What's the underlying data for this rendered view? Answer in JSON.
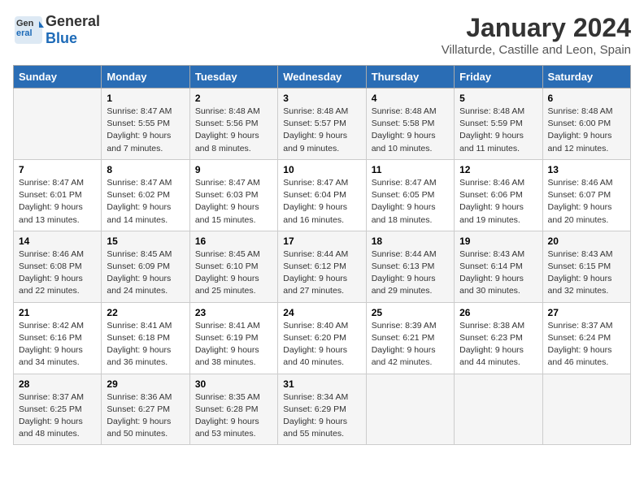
{
  "logo": {
    "general": "General",
    "blue": "Blue"
  },
  "title": "January 2024",
  "subtitle": "Villaturde, Castille and Leon, Spain",
  "days_header": [
    "Sunday",
    "Monday",
    "Tuesday",
    "Wednesday",
    "Thursday",
    "Friday",
    "Saturday"
  ],
  "weeks": [
    [
      {
        "num": "",
        "lines": []
      },
      {
        "num": "1",
        "lines": [
          "Sunrise: 8:47 AM",
          "Sunset: 5:55 PM",
          "Daylight: 9 hours",
          "and 7 minutes."
        ]
      },
      {
        "num": "2",
        "lines": [
          "Sunrise: 8:48 AM",
          "Sunset: 5:56 PM",
          "Daylight: 9 hours",
          "and 8 minutes."
        ]
      },
      {
        "num": "3",
        "lines": [
          "Sunrise: 8:48 AM",
          "Sunset: 5:57 PM",
          "Daylight: 9 hours",
          "and 9 minutes."
        ]
      },
      {
        "num": "4",
        "lines": [
          "Sunrise: 8:48 AM",
          "Sunset: 5:58 PM",
          "Daylight: 9 hours",
          "and 10 minutes."
        ]
      },
      {
        "num": "5",
        "lines": [
          "Sunrise: 8:48 AM",
          "Sunset: 5:59 PM",
          "Daylight: 9 hours",
          "and 11 minutes."
        ]
      },
      {
        "num": "6",
        "lines": [
          "Sunrise: 8:48 AM",
          "Sunset: 6:00 PM",
          "Daylight: 9 hours",
          "and 12 minutes."
        ]
      }
    ],
    [
      {
        "num": "7",
        "lines": [
          "Sunrise: 8:47 AM",
          "Sunset: 6:01 PM",
          "Daylight: 9 hours",
          "and 13 minutes."
        ]
      },
      {
        "num": "8",
        "lines": [
          "Sunrise: 8:47 AM",
          "Sunset: 6:02 PM",
          "Daylight: 9 hours",
          "and 14 minutes."
        ]
      },
      {
        "num": "9",
        "lines": [
          "Sunrise: 8:47 AM",
          "Sunset: 6:03 PM",
          "Daylight: 9 hours",
          "and 15 minutes."
        ]
      },
      {
        "num": "10",
        "lines": [
          "Sunrise: 8:47 AM",
          "Sunset: 6:04 PM",
          "Daylight: 9 hours",
          "and 16 minutes."
        ]
      },
      {
        "num": "11",
        "lines": [
          "Sunrise: 8:47 AM",
          "Sunset: 6:05 PM",
          "Daylight: 9 hours",
          "and 18 minutes."
        ]
      },
      {
        "num": "12",
        "lines": [
          "Sunrise: 8:46 AM",
          "Sunset: 6:06 PM",
          "Daylight: 9 hours",
          "and 19 minutes."
        ]
      },
      {
        "num": "13",
        "lines": [
          "Sunrise: 8:46 AM",
          "Sunset: 6:07 PM",
          "Daylight: 9 hours",
          "and 20 minutes."
        ]
      }
    ],
    [
      {
        "num": "14",
        "lines": [
          "Sunrise: 8:46 AM",
          "Sunset: 6:08 PM",
          "Daylight: 9 hours",
          "and 22 minutes."
        ]
      },
      {
        "num": "15",
        "lines": [
          "Sunrise: 8:45 AM",
          "Sunset: 6:09 PM",
          "Daylight: 9 hours",
          "and 24 minutes."
        ]
      },
      {
        "num": "16",
        "lines": [
          "Sunrise: 8:45 AM",
          "Sunset: 6:10 PM",
          "Daylight: 9 hours",
          "and 25 minutes."
        ]
      },
      {
        "num": "17",
        "lines": [
          "Sunrise: 8:44 AM",
          "Sunset: 6:12 PM",
          "Daylight: 9 hours",
          "and 27 minutes."
        ]
      },
      {
        "num": "18",
        "lines": [
          "Sunrise: 8:44 AM",
          "Sunset: 6:13 PM",
          "Daylight: 9 hours",
          "and 29 minutes."
        ]
      },
      {
        "num": "19",
        "lines": [
          "Sunrise: 8:43 AM",
          "Sunset: 6:14 PM",
          "Daylight: 9 hours",
          "and 30 minutes."
        ]
      },
      {
        "num": "20",
        "lines": [
          "Sunrise: 8:43 AM",
          "Sunset: 6:15 PM",
          "Daylight: 9 hours",
          "and 32 minutes."
        ]
      }
    ],
    [
      {
        "num": "21",
        "lines": [
          "Sunrise: 8:42 AM",
          "Sunset: 6:16 PM",
          "Daylight: 9 hours",
          "and 34 minutes."
        ]
      },
      {
        "num": "22",
        "lines": [
          "Sunrise: 8:41 AM",
          "Sunset: 6:18 PM",
          "Daylight: 9 hours",
          "and 36 minutes."
        ]
      },
      {
        "num": "23",
        "lines": [
          "Sunrise: 8:41 AM",
          "Sunset: 6:19 PM",
          "Daylight: 9 hours",
          "and 38 minutes."
        ]
      },
      {
        "num": "24",
        "lines": [
          "Sunrise: 8:40 AM",
          "Sunset: 6:20 PM",
          "Daylight: 9 hours",
          "and 40 minutes."
        ]
      },
      {
        "num": "25",
        "lines": [
          "Sunrise: 8:39 AM",
          "Sunset: 6:21 PM",
          "Daylight: 9 hours",
          "and 42 minutes."
        ]
      },
      {
        "num": "26",
        "lines": [
          "Sunrise: 8:38 AM",
          "Sunset: 6:23 PM",
          "Daylight: 9 hours",
          "and 44 minutes."
        ]
      },
      {
        "num": "27",
        "lines": [
          "Sunrise: 8:37 AM",
          "Sunset: 6:24 PM",
          "Daylight: 9 hours",
          "and 46 minutes."
        ]
      }
    ],
    [
      {
        "num": "28",
        "lines": [
          "Sunrise: 8:37 AM",
          "Sunset: 6:25 PM",
          "Daylight: 9 hours",
          "and 48 minutes."
        ]
      },
      {
        "num": "29",
        "lines": [
          "Sunrise: 8:36 AM",
          "Sunset: 6:27 PM",
          "Daylight: 9 hours",
          "and 50 minutes."
        ]
      },
      {
        "num": "30",
        "lines": [
          "Sunrise: 8:35 AM",
          "Sunset: 6:28 PM",
          "Daylight: 9 hours",
          "and 53 minutes."
        ]
      },
      {
        "num": "31",
        "lines": [
          "Sunrise: 8:34 AM",
          "Sunset: 6:29 PM",
          "Daylight: 9 hours",
          "and 55 minutes."
        ]
      },
      {
        "num": "",
        "lines": []
      },
      {
        "num": "",
        "lines": []
      },
      {
        "num": "",
        "lines": []
      }
    ]
  ]
}
